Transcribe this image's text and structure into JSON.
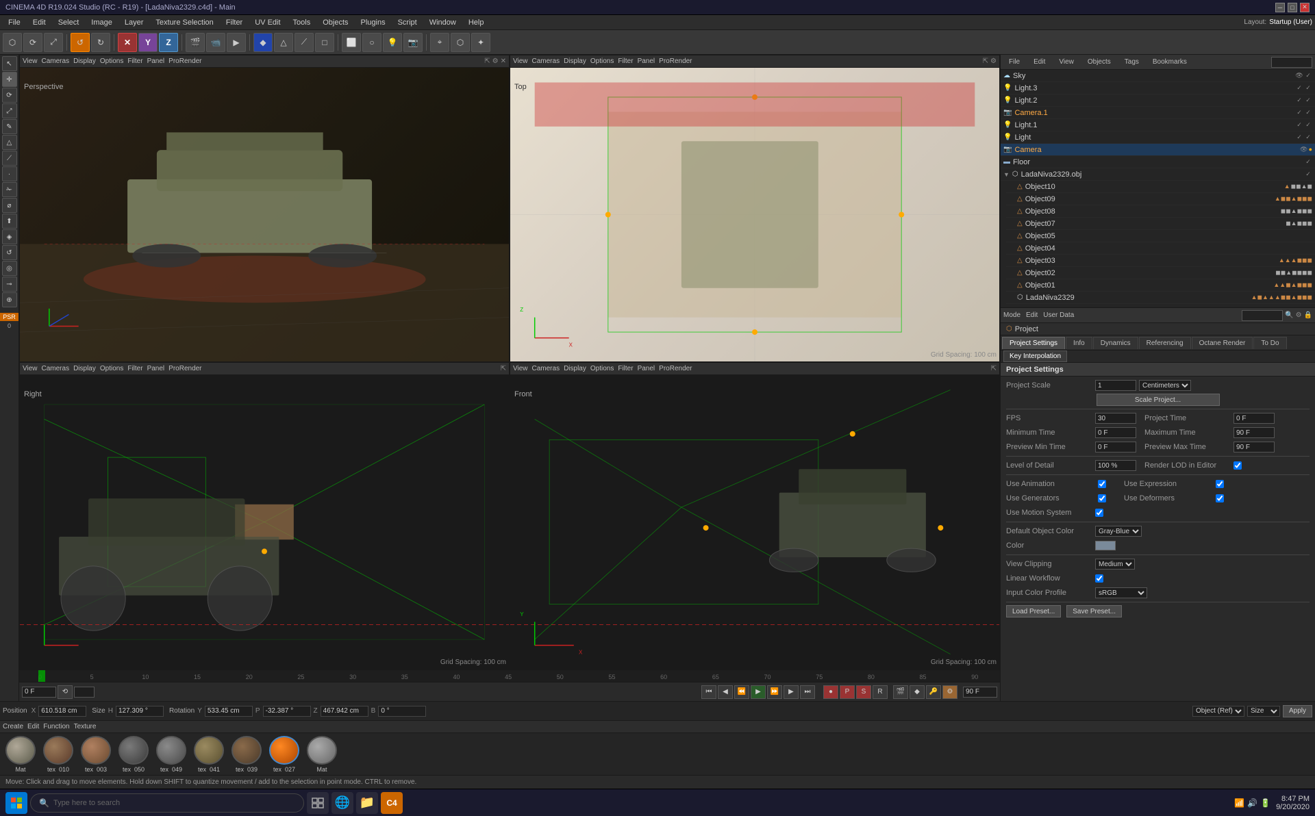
{
  "titlebar": {
    "text": "CINEMA 4D R19.024 Studio (RC - R19) - [LadaNiva2329.c4d] - Main",
    "minimize": "─",
    "maximize": "□",
    "close": "✕"
  },
  "menubar": {
    "items": [
      "File",
      "Edit",
      "Select",
      "Image",
      "Layer",
      "Texture Selection",
      "Filter",
      "UV Edit",
      "Tools",
      "Objects",
      "Plugins",
      "Script",
      "Window",
      "Help"
    ]
  },
  "toolbar": {
    "layout_label": "Layout:",
    "layout_value": "Startup (User)",
    "buttons": [
      "⬡",
      "★",
      "↺",
      "○",
      "✕",
      "❌",
      "X",
      "Y",
      "Z",
      "🎬",
      "📷",
      "▶",
      "▷",
      "◈",
      "✦",
      "⬟",
      "✎",
      "⬡",
      "▽",
      "⌖",
      "⬤",
      "⬜",
      "◻",
      "✦",
      "💡",
      "⬡",
      "⬤",
      "⬡",
      "⬡"
    ]
  },
  "viewports": {
    "menus": [
      "View",
      "Cameras",
      "Display",
      "Options",
      "Filter",
      "Panel",
      "ProRender"
    ],
    "perspective": {
      "label": "Perspective",
      "grid_spacing": ""
    },
    "top": {
      "label": "Top",
      "grid_spacing": "Grid Spacing: 100 cm"
    },
    "right": {
      "label": "Right",
      "grid_spacing": "Grid Spacing: 100 cm"
    },
    "front": {
      "label": "Front",
      "grid_spacing": "Grid Spacing: 100 cm"
    }
  },
  "object_manager": {
    "title": "Objects",
    "menus": [
      "File",
      "Edit",
      "View",
      "Objects",
      "Tags",
      "Bookmarks"
    ],
    "objects": [
      {
        "name": "Sky",
        "type": "sky",
        "indent": 0
      },
      {
        "name": "Light.3",
        "type": "light",
        "indent": 0
      },
      {
        "name": "Light.2",
        "type": "light",
        "indent": 0
      },
      {
        "name": "Camera.1",
        "type": "camera",
        "indent": 0
      },
      {
        "name": "Light.1",
        "type": "light",
        "indent": 0
      },
      {
        "name": "Light",
        "type": "light",
        "indent": 0
      },
      {
        "name": "Camera",
        "type": "camera",
        "indent": 0,
        "selected": true
      },
      {
        "name": "Floor",
        "type": "floor",
        "indent": 0
      },
      {
        "name": "LadaNiva2329.obj",
        "type": "group",
        "indent": 0
      },
      {
        "name": "Object10",
        "type": "mesh",
        "indent": 1
      },
      {
        "name": "Object09",
        "type": "mesh",
        "indent": 1
      },
      {
        "name": "Object08",
        "type": "mesh",
        "indent": 1
      },
      {
        "name": "Object07",
        "type": "mesh",
        "indent": 1
      },
      {
        "name": "Object05",
        "type": "mesh",
        "indent": 1
      },
      {
        "name": "Object04",
        "type": "mesh",
        "indent": 1
      },
      {
        "name": "Object03",
        "type": "mesh",
        "indent": 1
      },
      {
        "name": "Object02",
        "type": "mesh",
        "indent": 1
      },
      {
        "name": "Object01",
        "type": "mesh",
        "indent": 1
      },
      {
        "name": "LadaNiva2329",
        "type": "group",
        "indent": 1
      }
    ]
  },
  "attribute_manager": {
    "mode_items": [
      "Mode",
      "Edit",
      "User Data"
    ],
    "breadcrumb": "Project",
    "tabs": [
      "Project Settings",
      "Info",
      "Dynamics",
      "Referencing",
      "Octane Render",
      "To Do"
    ],
    "active_tab": "Project Settings",
    "section": "Project Settings",
    "fields": {
      "project_scale_label": "Project Scale",
      "project_scale_value": "1",
      "project_scale_unit": "Centimeters",
      "scale_project_btn": "Scale Project...",
      "fps_label": "FPS",
      "fps_value": "30",
      "project_time_label": "Project Time",
      "project_time_value": "0 F",
      "min_time_label": "Minimum Time",
      "min_time_value": "0 F",
      "max_time_label": "Maximum Time",
      "max_time_value": "90 F",
      "preview_min_label": "Preview Min Time",
      "preview_min_value": "0 F",
      "preview_max_label": "Preview Max Time",
      "preview_max_value": "90 F",
      "lod_label": "Level of Detail",
      "lod_value": "100 %",
      "render_lod_label": "Render LOD in Editor",
      "use_animation_label": "Use Animation",
      "use_expression_label": "Use Expression",
      "use_generators_label": "Use Generators",
      "use_deformers_label": "Use Deformers",
      "use_motion_label": "Use Motion System",
      "default_obj_color_label": "Default Object Color",
      "default_obj_color_value": "Gray-Blue",
      "color_label": "Color",
      "view_clipping_label": "View Clipping",
      "view_clipping_value": "Medium",
      "linear_workflow_label": "Linear Workflow",
      "input_color_label": "Input Color Profile",
      "input_color_value": "sRGB",
      "load_preset_btn": "Load Preset...",
      "save_preset_btn": "Save Preset..."
    },
    "key_interpolation_tab": "Key Interpolation"
  },
  "timeline": {
    "start": "0 F",
    "end": "90 F",
    "current": "0 F",
    "ticks": [
      "0",
      "5",
      "10",
      "15",
      "20",
      "25",
      "30",
      "35",
      "40",
      "45",
      "50",
      "55",
      "60",
      "65",
      "70",
      "75",
      "80",
      "85",
      "90"
    ]
  },
  "coordinates": {
    "position_label": "Position",
    "x_label": "X",
    "x_value": "610.518 cm",
    "y_label": "Y",
    "y_value": "533.45 cm",
    "z_label": "Z",
    "z_value": "467.942 cm",
    "size_label": "Size",
    "h_label": "H",
    "h_value": "127.309°",
    "p_label": "P",
    "p_value": "-32.387°",
    "b_label": "B",
    "b_value": "0°",
    "rotation_label": "Rotation",
    "obj_ref_label": "Object (Ref)",
    "size_ref_label": "Size",
    "apply_btn": "Apply"
  },
  "materials": {
    "menu_items": [
      "Create",
      "Edit",
      "Function",
      "Texture"
    ],
    "items": [
      {
        "name": "Mat",
        "color": "#8a8a7a"
      },
      {
        "name": "tex_010",
        "color": "#7a6a5a"
      },
      {
        "name": "tex_003",
        "color": "#8a7a6a"
      },
      {
        "name": "tex_050",
        "color": "#5a5a5a"
      },
      {
        "name": "tex_049",
        "color": "#6a6a6a"
      },
      {
        "name": "tex_041",
        "color": "#7a7060"
      },
      {
        "name": "tex_039",
        "color": "#6a5a4a"
      },
      {
        "name": "tex_027",
        "color": "#cc6600",
        "selected": true
      },
      {
        "name": "Mat",
        "color": "#8a8a8a"
      }
    ]
  },
  "status_bar": {
    "text": "Move: Click and drag to move elements. Hold down SHIFT to quantize movement / add to the selection in point mode. CTRL to remove."
  },
  "taskbar": {
    "search_placeholder": "Type here to search",
    "time": "8:47 PM",
    "date": "9/20/2020"
  }
}
